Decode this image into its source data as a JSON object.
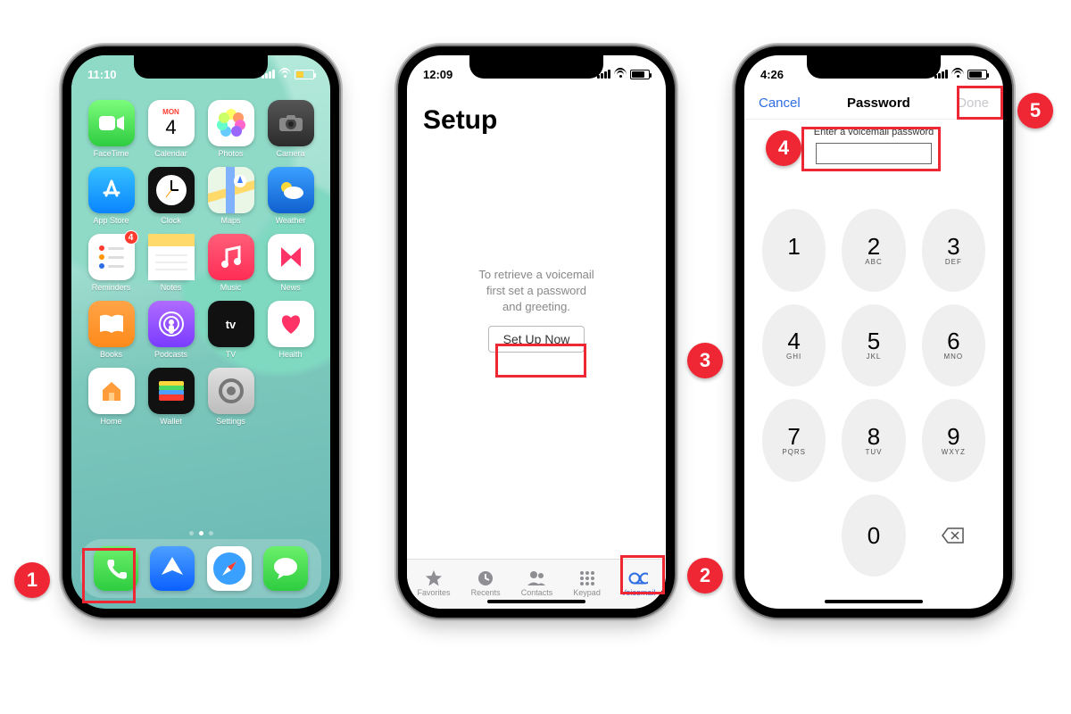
{
  "callouts": {
    "c1": "1",
    "c2": "2",
    "c3": "3",
    "c4": "4",
    "c5": "5"
  },
  "phone1": {
    "status": {
      "time": "11:10"
    },
    "apps": {
      "facetime": "FaceTime",
      "calendar": "Calendar",
      "calendar_day": "MON",
      "calendar_date": "4",
      "photos": "Photos",
      "camera": "Camera",
      "appstore": "App Store",
      "clock": "Clock",
      "maps": "Maps",
      "weather": "Weather",
      "reminders": "Reminders",
      "reminders_badge": "4",
      "notes": "Notes",
      "music": "Music",
      "news": "News",
      "books": "Books",
      "podcasts": "Podcasts",
      "tv": "TV",
      "health": "Health",
      "home": "Home",
      "wallet": "Wallet",
      "settings": "Settings"
    }
  },
  "phone2": {
    "status": {
      "time": "12:09"
    },
    "title": "Setup",
    "message_l1": "To retrieve a voicemail",
    "message_l2": "first set a password",
    "message_l3": "and greeting.",
    "button": "Set Up Now",
    "tabs": {
      "favorites": "Favorites",
      "recents": "Recents",
      "contacts": "Contacts",
      "keypad": "Keypad",
      "voicemail": "Voicemail"
    }
  },
  "phone3": {
    "status": {
      "time": "4:26"
    },
    "nav": {
      "cancel": "Cancel",
      "title": "Password",
      "done": "Done"
    },
    "prompt": "Enter a voicemail password",
    "keys": {
      "k1": "1",
      "k2": "2",
      "k2s": "ABC",
      "k3": "3",
      "k3s": "DEF",
      "k4": "4",
      "k4s": "GHI",
      "k5": "5",
      "k5s": "JKL",
      "k6": "6",
      "k6s": "MNO",
      "k7": "7",
      "k7s": "PQRS",
      "k8": "8",
      "k8s": "TUV",
      "k9": "9",
      "k9s": "WXYZ",
      "k0": "0"
    }
  }
}
